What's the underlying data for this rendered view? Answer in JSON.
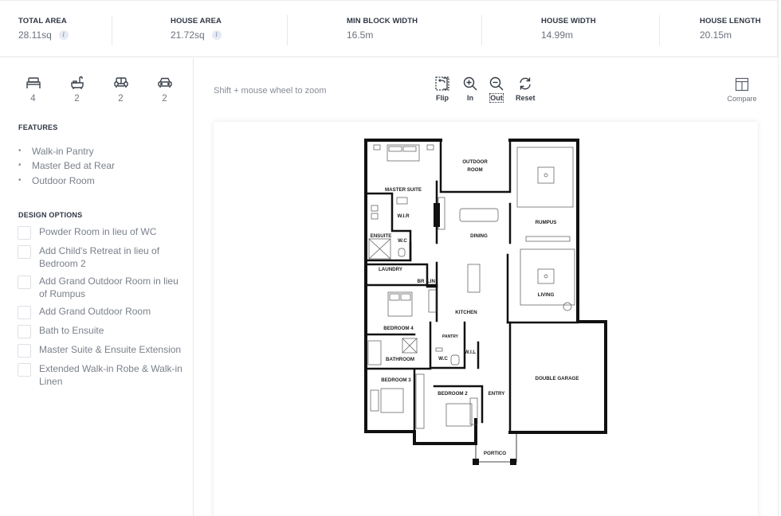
{
  "stats": [
    {
      "label": "TOTAL AREA",
      "value": "28.11sq",
      "info": true
    },
    {
      "label": "HOUSE AREA",
      "value": "21.72sq",
      "info": true
    },
    {
      "label": "MIN BLOCK WIDTH",
      "value": "16.5m",
      "info": false
    },
    {
      "label": "HOUSE WIDTH",
      "value": "14.99m",
      "info": false
    },
    {
      "label": "HOUSE LENGTH",
      "value": "20.15m",
      "info": false
    }
  ],
  "info_icon_glyph": "i",
  "amenities": [
    {
      "icon": "bed-icon",
      "count": "4"
    },
    {
      "icon": "bath-icon",
      "count": "2"
    },
    {
      "icon": "sofa-icon",
      "count": "2"
    },
    {
      "icon": "car-icon",
      "count": "2"
    }
  ],
  "features": {
    "title": "FEATURES",
    "bullet": "•",
    "items": [
      "Walk-in Pantry",
      "Master Bed at Rear",
      "Outdoor Room"
    ]
  },
  "design_options": {
    "title": "DESIGN OPTIONS",
    "items": [
      {
        "label": "Powder Room in lieu of WC",
        "checked": false
      },
      {
        "label": "Add Child's Retreat in lieu of Bedroom 2",
        "checked": false
      },
      {
        "label": "Add Grand Outdoor Room in lieu of Rumpus",
        "checked": false
      },
      {
        "label": "Add Grand Outdoor Room",
        "checked": false
      },
      {
        "label": "Bath to Ensuite",
        "checked": false
      },
      {
        "label": "Master Suite & Ensuite Extension",
        "checked": false
      },
      {
        "label": "Extended Walk-in Robe & Walk-in Linen",
        "checked": false
      }
    ]
  },
  "toolbar": {
    "hint": "Shift + mouse wheel to zoom",
    "flip": "Flip",
    "zoom_in": "In",
    "zoom_out": "Out",
    "reset": "Reset",
    "compare": "Compare"
  },
  "floorplan": {
    "rooms": {
      "master_suite": "MASTER SUITE",
      "outdoor_room_1": "OUTDOOR",
      "outdoor_room_2": "ROOM",
      "rumpus": "RUMPUS",
      "wir": "W.I.R",
      "ensuite": "ENSUITE",
      "wc_ensuite": "W.C",
      "dining": "DINING",
      "laundry": "LAUNDRY",
      "br": "BR",
      "lin": "LIN",
      "kitchen": "KITCHEN",
      "living": "LIVING",
      "bedroom_4": "BEDROOM 4",
      "pantry": "PANTRY",
      "wil": "W.I.L",
      "bathroom": "BATHROOM",
      "wc": "W.C",
      "double_garage": "DOUBLE GARAGE",
      "bedroom_3": "BEDROOM 3",
      "bedroom_2": "BEDROOM 2",
      "entry": "ENTRY",
      "portico": "PORTICO"
    }
  }
}
